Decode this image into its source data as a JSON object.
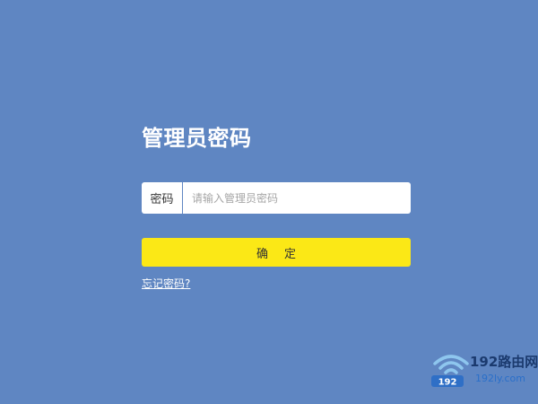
{
  "page": {
    "title": "管理员密码"
  },
  "password_field": {
    "label": "密码",
    "placeholder": "请输入管理员密码",
    "value": ""
  },
  "confirm_button": {
    "label": "确定"
  },
  "forgot_link": {
    "label": "忘记密码?"
  },
  "watermark": {
    "logo_text": "192路由网",
    "badge_text": "192",
    "domain": "192ly.com"
  },
  "colors": {
    "background": "#5f86c2",
    "button": "#fbe816",
    "text_light": "#ffffff"
  }
}
